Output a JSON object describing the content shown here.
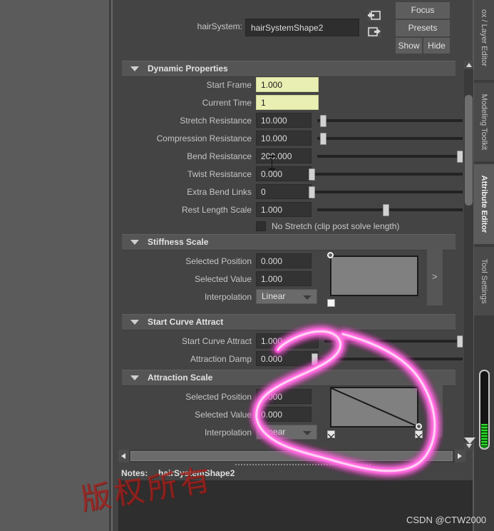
{
  "app": {
    "panel_title": "Attribute Editor"
  },
  "header": {
    "node_label": "hairSystem:",
    "node_value": "hairSystemShape2",
    "icon_in": "arrow-into-box-icon",
    "icon_out": "arrow-out-of-box-icon",
    "focus_label": "Focus",
    "presets_label": "Presets",
    "show_label": "Show",
    "hide_label": "Hide"
  },
  "sections": {
    "dynamic_properties": {
      "title": "Dynamic Properties",
      "rows": [
        {
          "label": "Start Frame",
          "value": "1.000",
          "field": "yellow",
          "slider": false
        },
        {
          "label": "Current Time",
          "value": "1",
          "field": "yellow",
          "slider": false
        },
        {
          "label": "Stretch Resistance",
          "value": "10.000",
          "field": "dark",
          "slider": true,
          "pct": 4
        },
        {
          "label": "Compression Resistance",
          "value": "10.000",
          "field": "dark",
          "slider": true,
          "pct": 4
        },
        {
          "label": "Bend Resistance",
          "value": "200.000",
          "field": "dark",
          "slider": true,
          "pct": 99
        },
        {
          "label": "Twist Resistance",
          "value": "0.000",
          "field": "dark",
          "slider": true,
          "pct": 0
        },
        {
          "label": "Extra Bend Links",
          "value": "0",
          "field": "dark",
          "slider": true,
          "pct": 0
        },
        {
          "label": "Rest Length Scale",
          "value": "1.000",
          "field": "dark",
          "slider": true,
          "pct": 45
        }
      ],
      "checkbox_label": "No Stretch (clip post solve length)",
      "checkbox_checked": false
    },
    "stiffness_scale": {
      "title": "Stiffness Scale",
      "selected_position_label": "Selected Position",
      "selected_position_value": "0.000",
      "selected_value_label": "Selected Value",
      "selected_value_value": "1.000",
      "interpolation_label": "Interpolation",
      "interpolation_value": "Linear",
      "expand_glyph": ">",
      "ramp_shape": "flat-full"
    },
    "start_curve_attract": {
      "title": "Start Curve Attract",
      "rows": [
        {
          "label": "Start Curve Attract",
          "value": "1.000",
          "pct": 98
        },
        {
          "label": "Attraction Damp",
          "value": "0.000",
          "pct": 0
        }
      ]
    },
    "attraction_scale": {
      "title": "Attraction Scale",
      "selected_position_label": "Selected Position",
      "selected_position_value": "1.000",
      "selected_value_label": "Selected Value",
      "selected_value_value": "0.000",
      "interpolation_label": "Interpolation",
      "interpolation_value": "Linear",
      "expand_glyph": ">",
      "ramp_shape": "linear-descending"
    }
  },
  "notes": {
    "label": "Notes:",
    "value": "hairSystemShape2"
  },
  "right_tabs": [
    {
      "label": "ox / Layer Editor",
      "selected": false
    },
    {
      "label": "Modeling Toolkit",
      "selected": false
    },
    {
      "label": "Attribute Editor",
      "selected": true
    },
    {
      "label": "Tool Settings",
      "selected": false
    }
  ],
  "watermarks": {
    "cn_text": "版权所有",
    "csdn_text": "CSDN @CTW2000"
  },
  "annotation": {
    "color": "#ff2ed2",
    "shape": "hand-drawn-ellipse-lasso"
  }
}
